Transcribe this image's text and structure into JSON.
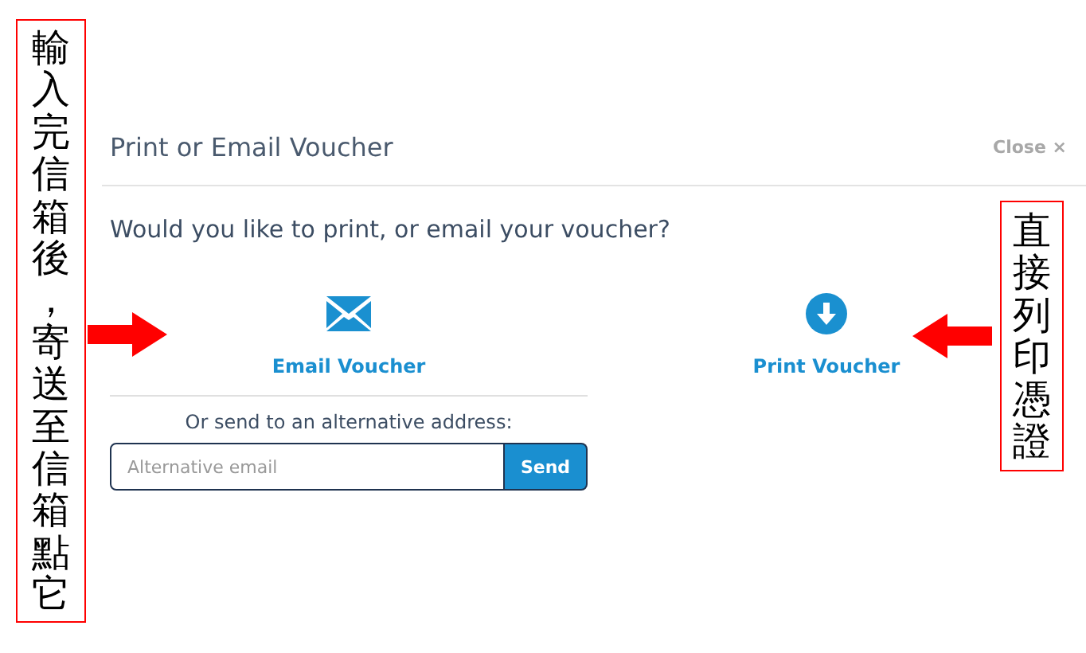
{
  "annotations": [
    {
      "kind": "left",
      "text": "輸入完信箱後，寄送至信箱點它"
    },
    {
      "kind": "right",
      "text": "直接列印憑證"
    }
  ],
  "dialog": {
    "title": "Print or Email Voucher",
    "close": "Close ×",
    "question": "Would you like to print, or email your voucher?",
    "options": [
      {
        "kind": "email",
        "label": "Email Voucher"
      },
      {
        "kind": "print",
        "label": "Print Voucher"
      }
    ],
    "alternative": {
      "prompt": "Or send to an alternative address:",
      "placeholder": "Alternative email",
      "button": "Send"
    }
  }
}
